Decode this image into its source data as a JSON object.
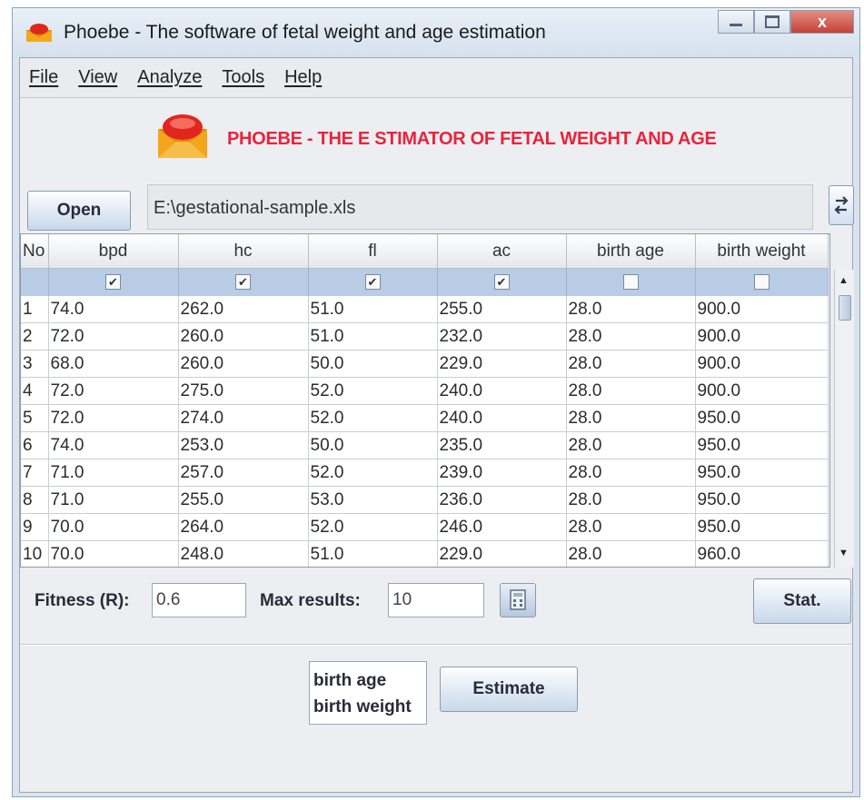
{
  "window": {
    "title": "Phoebe - The software of fetal weight and age estimation",
    "close_glyph": "x"
  },
  "menu": [
    "File",
    "View",
    "Analyze",
    "Tools",
    "Help"
  ],
  "banner": "PHOEBE - THE E STIMATOR OF FETAL WEIGHT AND AGE",
  "toolbar": {
    "open_label": "Open",
    "file_path": "E:\\gestational-sample.xls"
  },
  "table": {
    "columns": [
      "No",
      "bpd",
      "hc",
      "fl",
      "ac",
      "birth age",
      "birth weight"
    ],
    "checked": [
      true,
      true,
      true,
      true,
      false,
      false
    ],
    "rows": [
      [
        "1",
        "74.0",
        "262.0",
        "51.0",
        "255.0",
        "28.0",
        "900.0"
      ],
      [
        "2",
        "72.0",
        "260.0",
        "51.0",
        "232.0",
        "28.0",
        "900.0"
      ],
      [
        "3",
        "68.0",
        "260.0",
        "50.0",
        "229.0",
        "28.0",
        "900.0"
      ],
      [
        "4",
        "72.0",
        "275.0",
        "52.0",
        "240.0",
        "28.0",
        "900.0"
      ],
      [
        "5",
        "72.0",
        "274.0",
        "52.0",
        "240.0",
        "28.0",
        "950.0"
      ],
      [
        "6",
        "74.0",
        "253.0",
        "50.0",
        "235.0",
        "28.0",
        "950.0"
      ],
      [
        "7",
        "71.0",
        "257.0",
        "52.0",
        "239.0",
        "28.0",
        "950.0"
      ],
      [
        "8",
        "71.0",
        "255.0",
        "53.0",
        "236.0",
        "28.0",
        "950.0"
      ],
      [
        "9",
        "70.0",
        "264.0",
        "52.0",
        "246.0",
        "28.0",
        "950.0"
      ],
      [
        "10",
        "70.0",
        "248.0",
        "51.0",
        "229.0",
        "28.0",
        "960.0"
      ]
    ]
  },
  "params": {
    "fitness_label": "Fitness (R):",
    "fitness_value": "0.6",
    "max_results_label": "Max results:",
    "max_results_value": "10",
    "stat_label": "Stat."
  },
  "estimate": {
    "targets": [
      "birth age",
      "birth weight"
    ],
    "button_label": "Estimate"
  },
  "colors": {
    "banner": "#e8243c",
    "header_selection": "#b9cce6",
    "window_frame": "#dbe4ee"
  }
}
